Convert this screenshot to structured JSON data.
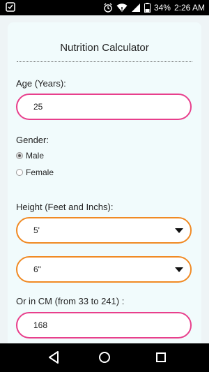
{
  "status_bar": {
    "battery_percent": "34%",
    "time": "2:26 AM"
  },
  "form": {
    "title": "Nutrition Calculator",
    "age": {
      "label": "Age (Years):",
      "value": "25"
    },
    "gender": {
      "label": "Gender:",
      "options": [
        "Male",
        "Female"
      ],
      "selected": "Male"
    },
    "height": {
      "label": "Height (Feet and Inchs):",
      "feet_value": "5'",
      "inches_value": "6\""
    },
    "cm": {
      "label": "Or in CM (from 33 to 241) :",
      "value": "168"
    }
  },
  "colors": {
    "pink_border": "#e83f8c",
    "orange_border": "#f08a24",
    "card_bg": "#f1fbfc"
  },
  "icons": {
    "status_left": "app-notification-icon",
    "status_right": [
      "alarm-icon",
      "wifi-icon",
      "signal-icon",
      "battery-icon"
    ],
    "nav": [
      "back-icon",
      "home-icon",
      "recents-icon"
    ]
  }
}
